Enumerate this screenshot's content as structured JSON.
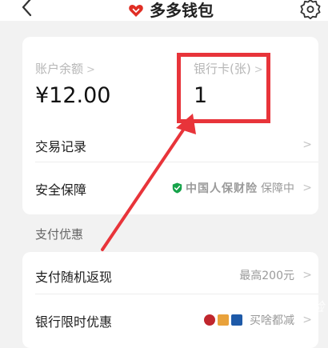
{
  "header": {
    "title": "多多钱包"
  },
  "balance": {
    "label": "账户余额",
    "value": "¥12.00"
  },
  "bank_card": {
    "label": "银行卡(张)",
    "value": "1"
  },
  "rows": {
    "transactions": "交易记录",
    "security": {
      "label": "安全保障",
      "insurer": "中国人保财险",
      "status": "保障中"
    }
  },
  "section": {
    "title": "支付优惠"
  },
  "promo": {
    "cashback": {
      "label": "支付随机返现",
      "detail": "最高200元"
    },
    "bank_offer": {
      "label": "银行限时优惠",
      "detail": "买啥都减"
    }
  },
  "colors": {
    "accent": "#e02e24",
    "highlight": "#e8343a",
    "shield": "#16a34a"
  }
}
